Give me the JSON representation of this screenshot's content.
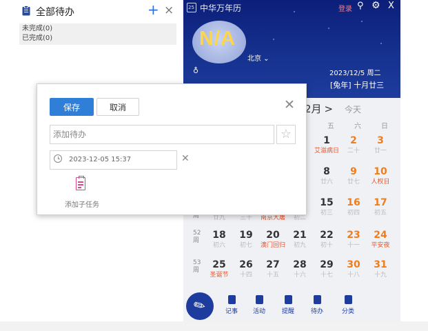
{
  "todo_panel": {
    "title": "全部待办",
    "add_symbol": "+",
    "close_symbol": "×",
    "groups": [
      "未完成(0)",
      "已完成(0)"
    ]
  },
  "calendar": {
    "app_title": "中华万年历",
    "app_logo_text": "25",
    "login": "登录",
    "weather": "N/A",
    "city": "北京 ⌄",
    "thermo": "♁",
    "current_date": "2023/12/5 周二",
    "lunar_date": "[兔年] 十月廿三",
    "month_label": "2月",
    "nav_arrow": ">",
    "today": "今天",
    "weekdays": [
      "五",
      "六",
      "日"
    ],
    "week_labels": [
      "52 周",
      "53 周"
    ],
    "week_hint": "周",
    "rows": [
      {
        "days": [
          {
            "n": "1",
            "l": "艾滋病日"
          },
          {
            "n": "2",
            "l": "二十"
          },
          {
            "n": "3",
            "l": "廿一"
          }
        ]
      },
      {
        "days": [
          {
            "n": "8",
            "l": "廿六"
          },
          {
            "n": "9",
            "l": "廿七"
          },
          {
            "n": "10",
            "l": "人权日"
          }
        ]
      },
      {
        "days": [
          {
            "n": "15",
            "l": "初三"
          },
          {
            "n": "16",
            "l": "初四"
          },
          {
            "n": "17",
            "l": "初五"
          }
        ],
        "partial": [
          "廿九",
          "三十",
          "南京大屠",
          "初二"
        ]
      },
      {
        "days": [
          {
            "n": "18",
            "l": "初六"
          },
          {
            "n": "19",
            "l": "初七"
          },
          {
            "n": "20",
            "l": "澳门回归"
          },
          {
            "n": "21",
            "l": "初九"
          },
          {
            "n": "22",
            "l": "初十"
          },
          {
            "n": "23",
            "l": "十一"
          },
          {
            "n": "24",
            "l": "平安夜"
          }
        ]
      },
      {
        "days": [
          {
            "n": "25",
            "l": "圣诞节"
          },
          {
            "n": "26",
            "l": "十四"
          },
          {
            "n": "27",
            "l": "十五"
          },
          {
            "n": "28",
            "l": "十六"
          },
          {
            "n": "29",
            "l": "十七"
          },
          {
            "n": "30",
            "l": "十八"
          },
          {
            "n": "31",
            "l": "十九"
          }
        ]
      }
    ],
    "bottom_nav": [
      "记事",
      "活动",
      "提醒",
      "待办",
      "分类"
    ],
    "colors": {
      "header": "#16318e",
      "weekend": "#ef7d1c",
      "festival": "#e8572b",
      "login": "#ff7a7a"
    }
  },
  "dialog": {
    "save": "保存",
    "cancel": "取消",
    "input_placeholder": "添加待办",
    "datetime": "2023-12-05 15:37",
    "subtask": "添加子任务",
    "colors": {
      "primary": "#2f7fd8",
      "subtask_icon": "#e0458b"
    }
  }
}
